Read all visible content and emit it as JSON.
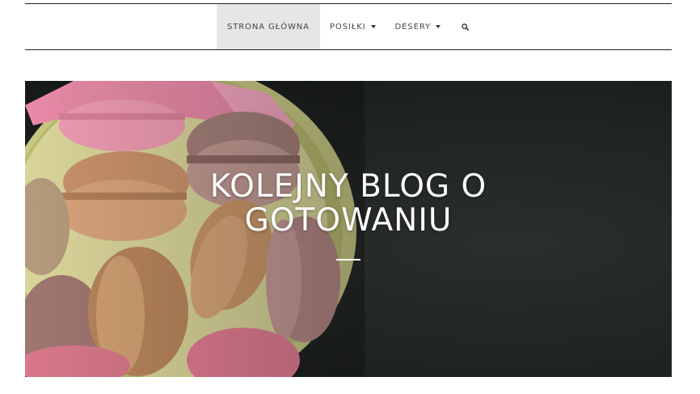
{
  "nav": {
    "items": [
      {
        "label": "STRONA GŁÓWNA",
        "active": true,
        "dropdown": false
      },
      {
        "label": "POSIŁKI",
        "active": false,
        "dropdown": true
      },
      {
        "label": "DESERY",
        "active": false,
        "dropdown": true
      }
    ],
    "search_icon": "search-icon"
  },
  "hero": {
    "title": "KOLEJNY BLOG O GOTOWANIU",
    "background": "macarons-in-bowl-on-dark-background"
  },
  "colors": {
    "nav_active_bg": "#e6e6e6",
    "hero_dark": "#1e2221",
    "title": "#ffffff"
  }
}
